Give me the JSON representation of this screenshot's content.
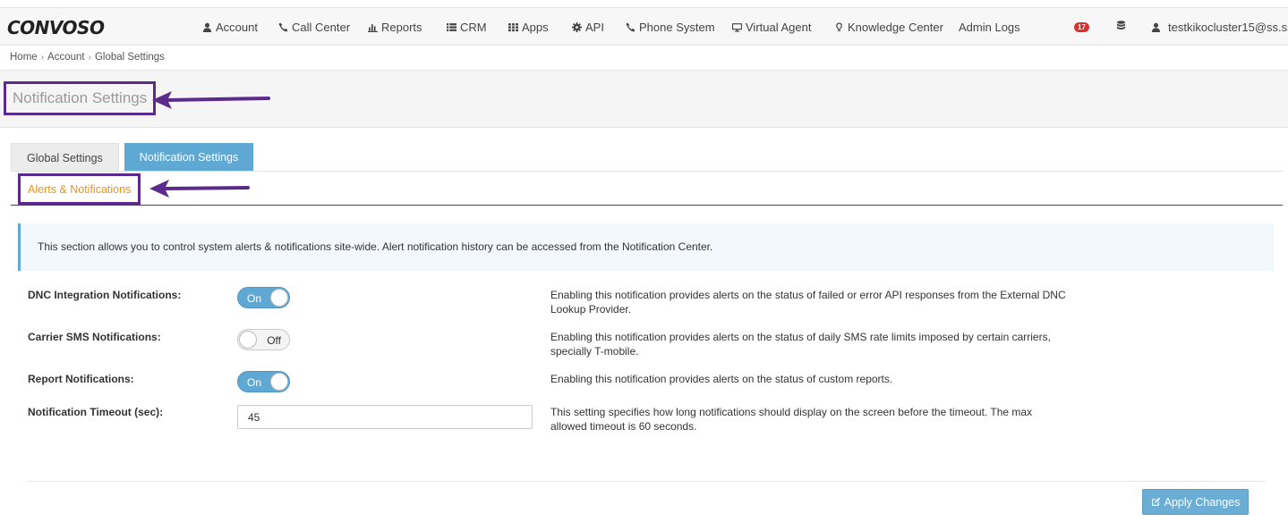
{
  "app": {
    "logo_text": "CONVOSO"
  },
  "nav": {
    "items": [
      {
        "label": "Account",
        "icon": "user-icon"
      },
      {
        "label": "Call Center",
        "icon": "phone-icon"
      },
      {
        "label": "Reports",
        "icon": "bar-chart-icon"
      },
      {
        "label": "CRM",
        "icon": "list-icon"
      },
      {
        "label": "Apps",
        "icon": "grid-icon"
      },
      {
        "label": "API",
        "icon": "gear-icon"
      },
      {
        "label": "Phone System",
        "icon": "phone-icon"
      },
      {
        "label": "Virtual Agent",
        "icon": "monitor-icon"
      },
      {
        "label": "Knowledge Center",
        "icon": "lightbulb-icon"
      },
      {
        "label": "Admin Logs",
        "icon": ""
      }
    ],
    "notification_count": "17",
    "user_email": "testkikocluster15@ss.ss"
  },
  "breadcrumb": [
    "Home",
    "Account",
    "Global Settings"
  ],
  "header": {
    "title": "Notification Settings"
  },
  "tabs": [
    {
      "label": "Global Settings",
      "active": false
    },
    {
      "label": "Notification Settings",
      "active": true
    }
  ],
  "subtab": {
    "label": "Alerts & Notifications"
  },
  "info": {
    "text": "This section allows you to control system alerts & notifications site-wide. Alert notification history can be accessed from the Notification Center."
  },
  "settings": {
    "dnc": {
      "label": "DNC Integration Notifications:",
      "state": "On",
      "desc": "Enabling this notification provides alerts on the status of failed or error API responses from the External DNC Lookup Provider."
    },
    "carrier_sms": {
      "label": "Carrier SMS Notifications:",
      "state": "Off",
      "desc": "Enabling this notification provides alerts on the status of daily SMS rate limits imposed by certain carriers, specially T-mobile."
    },
    "report": {
      "label": "Report Notifications:",
      "state": "On",
      "desc": "Enabling this notification provides alerts on the status of custom reports."
    },
    "timeout": {
      "label": "Notification Timeout (sec):",
      "value": "45",
      "desc": "This setting specifies how long notifications should display on the screen before the timeout. The max allowed timeout is 60 seconds."
    }
  },
  "actions": {
    "apply_label": "Apply Changes"
  },
  "colors": {
    "accent": "#5fa8d3",
    "highlight": "#5b2a8c",
    "subtab": "#e8941f",
    "badge": "#d9312e"
  }
}
